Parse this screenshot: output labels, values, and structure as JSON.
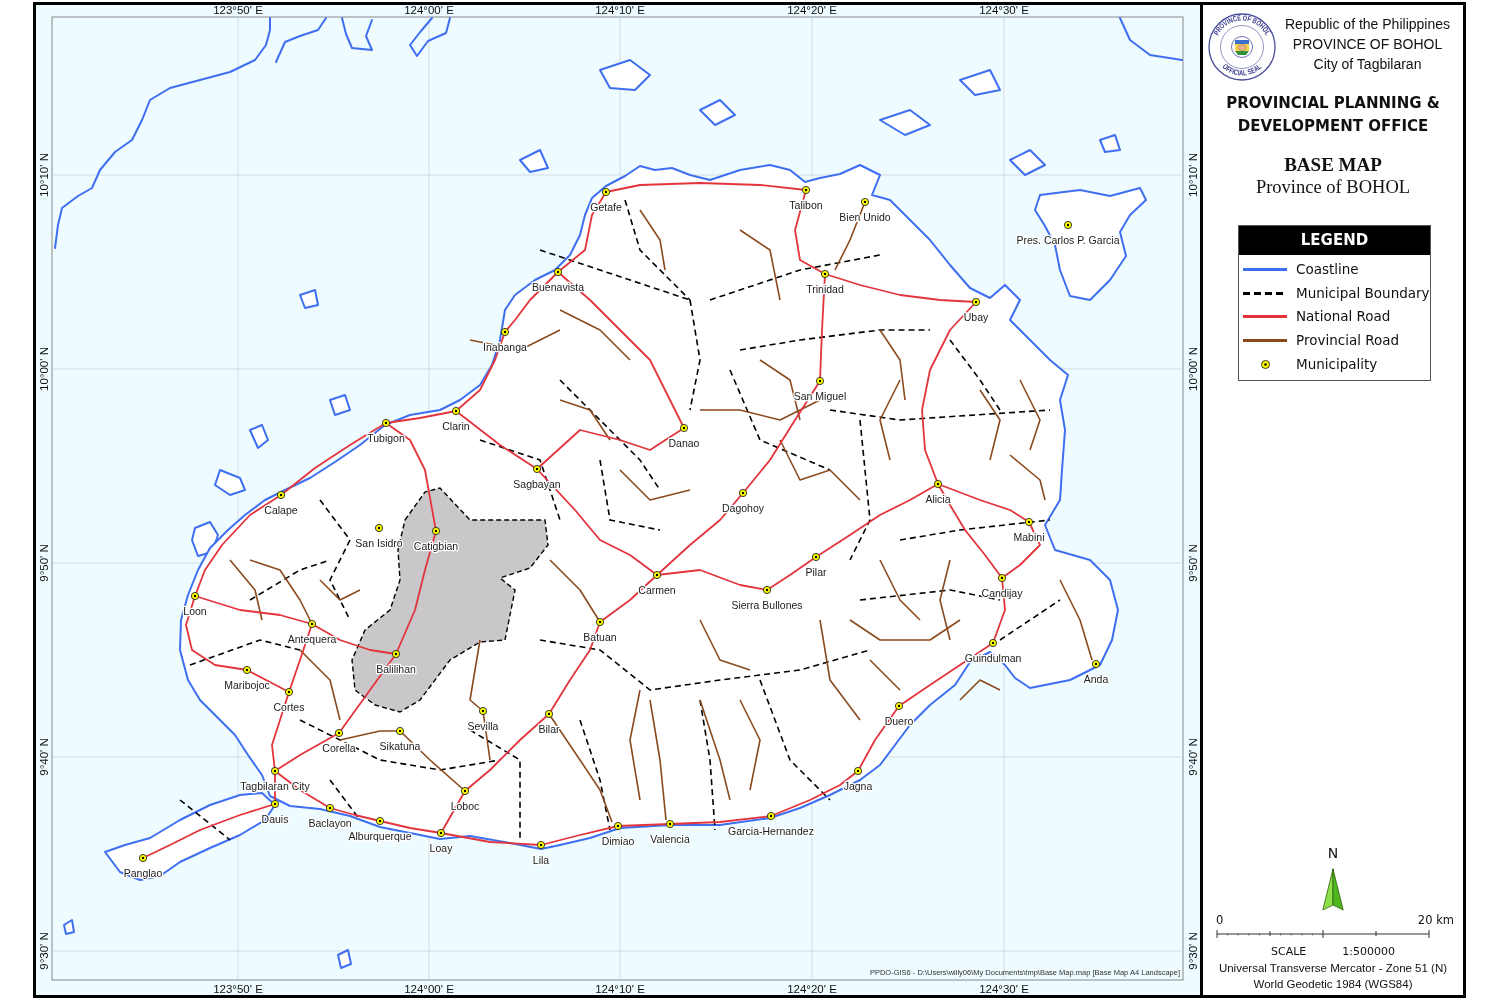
{
  "map": {
    "longitude_labels_top": [
      "123°50' E",
      "124°00' E",
      "124°10' E",
      "124°20' E",
      "124°30' E"
    ],
    "latitude_labels_left": [
      "10°10' N",
      "10°00' N",
      "9°50' N",
      "9°40' N",
      "9°30' N"
    ],
    "latitude_labels_right": [
      "10°10' N",
      "10°00' N",
      "9°50' N",
      "9°40' N",
      "9°30' N"
    ],
    "municipalities": [
      {
        "name": "Getafe"
      },
      {
        "name": "Talibon"
      },
      {
        "name": "Bien Unido"
      },
      {
        "name": "Pres. Carlos P. Garcia"
      },
      {
        "name": "Buenavista"
      },
      {
        "name": "Trinidad"
      },
      {
        "name": "Ubay"
      },
      {
        "name": "Inabanga"
      },
      {
        "name": "San Miguel"
      },
      {
        "name": "Clarin"
      },
      {
        "name": "Tubigon"
      },
      {
        "name": "Danao"
      },
      {
        "name": "Sagbayan"
      },
      {
        "name": "Alicia"
      },
      {
        "name": "Calape"
      },
      {
        "name": "Dagohoy"
      },
      {
        "name": "Mabini"
      },
      {
        "name": "San Isidro"
      },
      {
        "name": "Catigbian"
      },
      {
        "name": "Pilar"
      },
      {
        "name": "Candijay"
      },
      {
        "name": "Carmen"
      },
      {
        "name": "Sierra Bullones"
      },
      {
        "name": "Loon"
      },
      {
        "name": "Antequera"
      },
      {
        "name": "Batuan"
      },
      {
        "name": "Guindulman"
      },
      {
        "name": "Balilihan"
      },
      {
        "name": "Anda"
      },
      {
        "name": "Maribojoc"
      },
      {
        "name": "Cortes"
      },
      {
        "name": "Duero"
      },
      {
        "name": "Sevilla"
      },
      {
        "name": "Bilar"
      },
      {
        "name": "Corella"
      },
      {
        "name": "Sikatuna"
      },
      {
        "name": "Jagna"
      },
      {
        "name": "Tagbilaran City"
      },
      {
        "name": "Dauis"
      },
      {
        "name": "Baclayon"
      },
      {
        "name": "Loboc"
      },
      {
        "name": "Garcia-Hernandez"
      },
      {
        "name": "Alburquerque"
      },
      {
        "name": "Dimiao"
      },
      {
        "name": "Valencia"
      },
      {
        "name": "Loay"
      },
      {
        "name": "Lila"
      },
      {
        "name": "Panglao"
      }
    ],
    "source_note": "PPDO-GIS6 - D:\\Users\\willy06\\My Documents\\tmp\\Base Map.map [Base Map A4 Landscape]",
    "longitude_labels_bottom": [
      "123°50' E",
      "124°00' E",
      "124°10' E",
      "124°20' E",
      "124°30' E"
    ]
  },
  "seal": {
    "top_text": "PROVINCE OF BOHOL",
    "bottom_text": "OFFICIAL SEAL"
  },
  "title_block": {
    "header_lines": [
      "Republic of the Philippines",
      "PROVINCE OF BOHOL",
      "City of Tagbilaran"
    ],
    "office": "PROVINCIAL PLANNING & DEVELOPMENT OFFICE",
    "map_title": "BASE MAP",
    "map_subtitle": "Province of BOHOL"
  },
  "legend": {
    "title": "LEGEND",
    "items": [
      {
        "label": "Coastline",
        "kind": "line",
        "color": "#3f6ff0"
      },
      {
        "label": "Municipal Boundary",
        "kind": "dashed",
        "color": "#000000"
      },
      {
        "label": "National Road",
        "kind": "line",
        "color": "#e3343c"
      },
      {
        "label": "Provincial Road",
        "kind": "line",
        "color": "#8b4a1e"
      },
      {
        "label": "Municipality",
        "kind": "point",
        "color": "#ffff00"
      }
    ]
  },
  "north_arrow": {
    "label": "N"
  },
  "scale": {
    "start_label": "0",
    "end_label": "20 km",
    "label": "SCALE",
    "ratio": "1:500000",
    "projection": "Universal Transverse Mercator - Zone 51 (N)",
    "datum": "World Geodetic 1984 (WGS84)"
  }
}
